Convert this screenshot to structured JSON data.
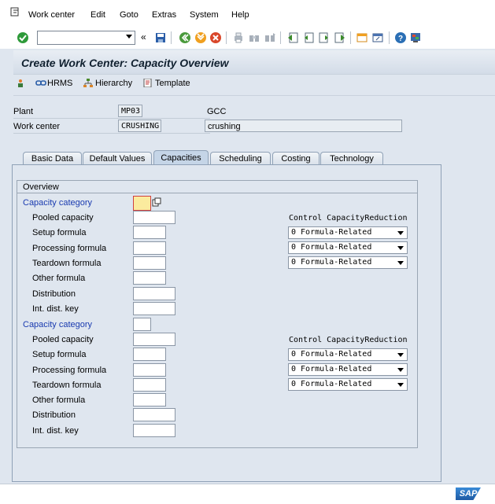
{
  "menu": [
    "Work center",
    "Edit",
    "Goto",
    "Extras",
    "System",
    "Help"
  ],
  "toolbar": {
    "command_value": "",
    "icons": [
      "enter-icon",
      "save-icon",
      "back-icon",
      "exit-icon",
      "cancel-icon",
      "print-icon",
      "find-icon",
      "find-next-icon",
      "first-page-icon",
      "previous-page-icon",
      "next-page-icon",
      "last-page-icon",
      "create-session-icon",
      "shortcut-icon",
      "help-icon",
      "customize-layout-icon"
    ]
  },
  "page": {
    "title": "Create Work Center: Capacity Overview"
  },
  "app_toolbar": {
    "hrms": "HRMS",
    "hierarchy": "Hierarchy",
    "template": "Template"
  },
  "header": {
    "plant_label": "Plant",
    "plant_value": "MP03",
    "plant_desc": "GCC",
    "work_center_label": "Work center",
    "work_center_value": "CRUSHING",
    "work_center_desc": "crushing"
  },
  "tabs": [
    "Basic Data",
    "Default Values",
    "Capacities",
    "Scheduling",
    "Costing",
    "Technology"
  ],
  "active_tab": "Capacities",
  "overview": {
    "title": "Overview",
    "control_header": "Control CapacityReduction",
    "category_label": "Capacity category",
    "rows": [
      "Pooled capacity",
      "Setup formula",
      "Processing formula",
      "Teardown formula",
      "Other formula",
      "Distribution",
      "Int. dist. key"
    ],
    "blocks": [
      {
        "category_value": "",
        "selects": [
          "0 Formula-Related",
          "0 Formula-Related",
          "0 Formula-Related"
        ]
      },
      {
        "category_value": "",
        "selects": [
          "0 Formula-Related",
          "0 Formula-Related",
          "0 Formula-Related"
        ]
      }
    ]
  },
  "status": {
    "logo": "SAP"
  }
}
